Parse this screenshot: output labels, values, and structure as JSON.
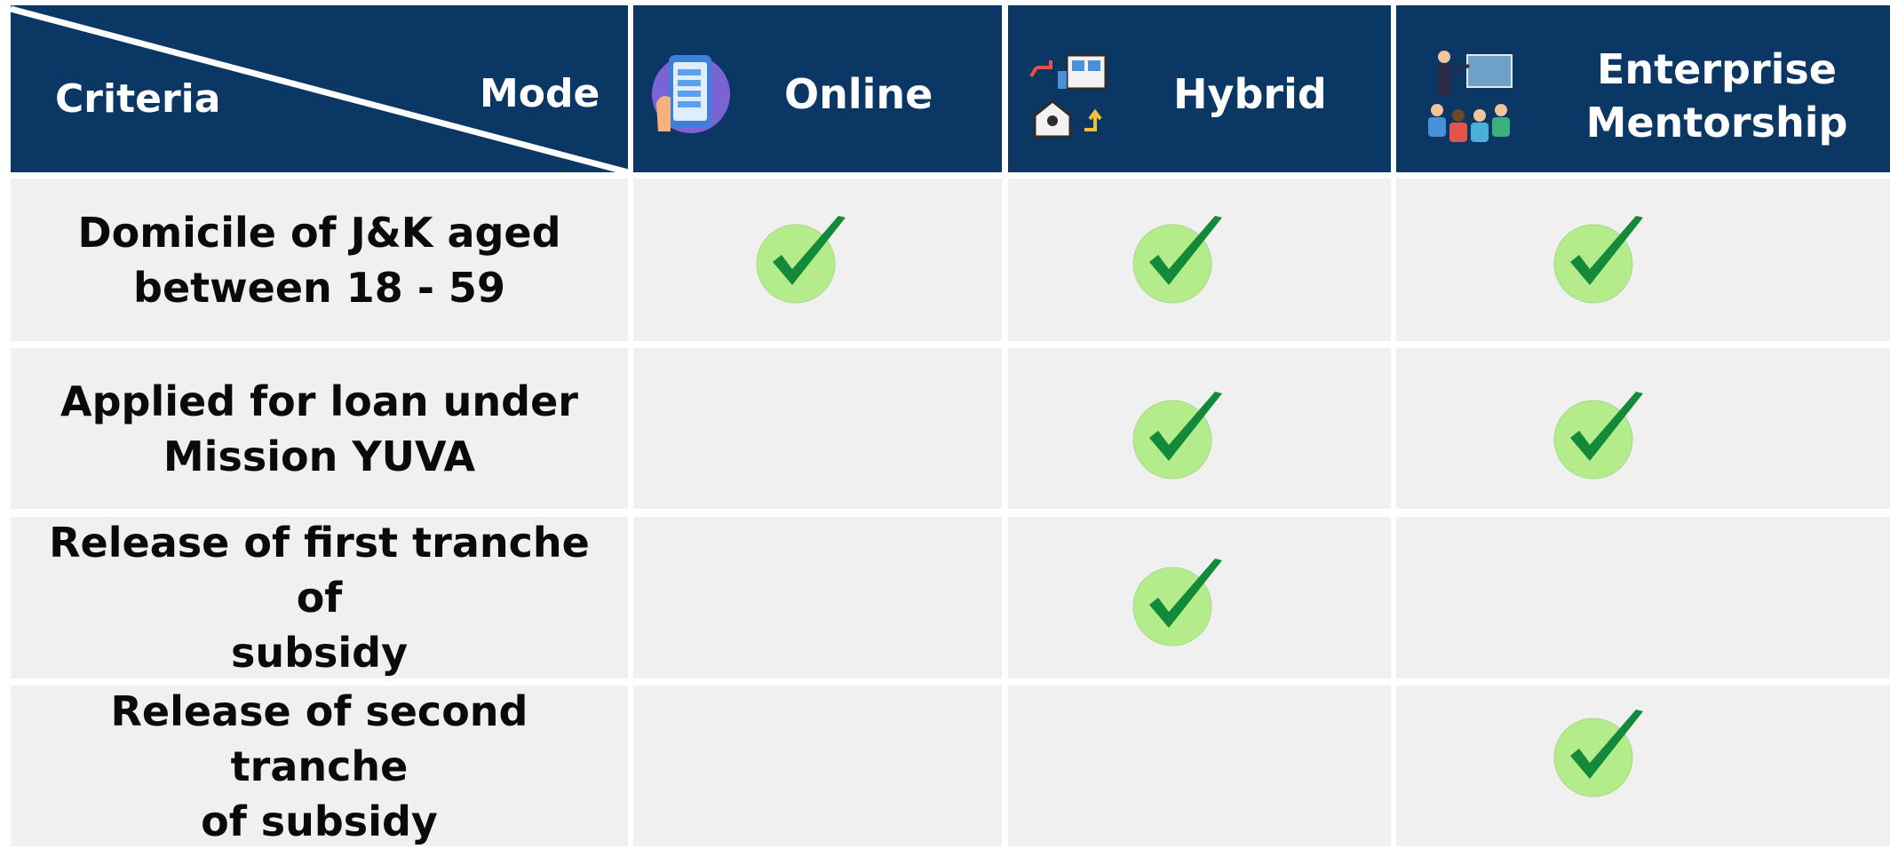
{
  "header": {
    "criteria_label": "Criteria",
    "mode_label": "Mode",
    "modes": [
      {
        "label": "Online",
        "icon": "mobile-checklist-icon"
      },
      {
        "label": "Hybrid",
        "icon": "hybrid-office-home-icon"
      },
      {
        "label": "Enterprise\nMentorship",
        "icon": "mentor-presentation-icon"
      }
    ]
  },
  "rows": [
    {
      "criteria": "Domicile of J&K aged\nbetween 18 - 59",
      "checks": [
        true,
        true,
        true
      ]
    },
    {
      "criteria": "Applied for loan under\nMission YUVA",
      "checks": [
        false,
        true,
        true
      ]
    },
    {
      "criteria": "Release of first tranche of\nsubsidy",
      "checks": [
        false,
        true,
        false
      ]
    },
    {
      "criteria": "Release of second tranche\nof subsidy",
      "checks": [
        false,
        false,
        true
      ]
    }
  ],
  "colors": {
    "header_bg": "#0b3764",
    "cell_bg": "#f0f0f0",
    "check_circle": "#b4ec8c",
    "check_mark": "#138a3a"
  }
}
